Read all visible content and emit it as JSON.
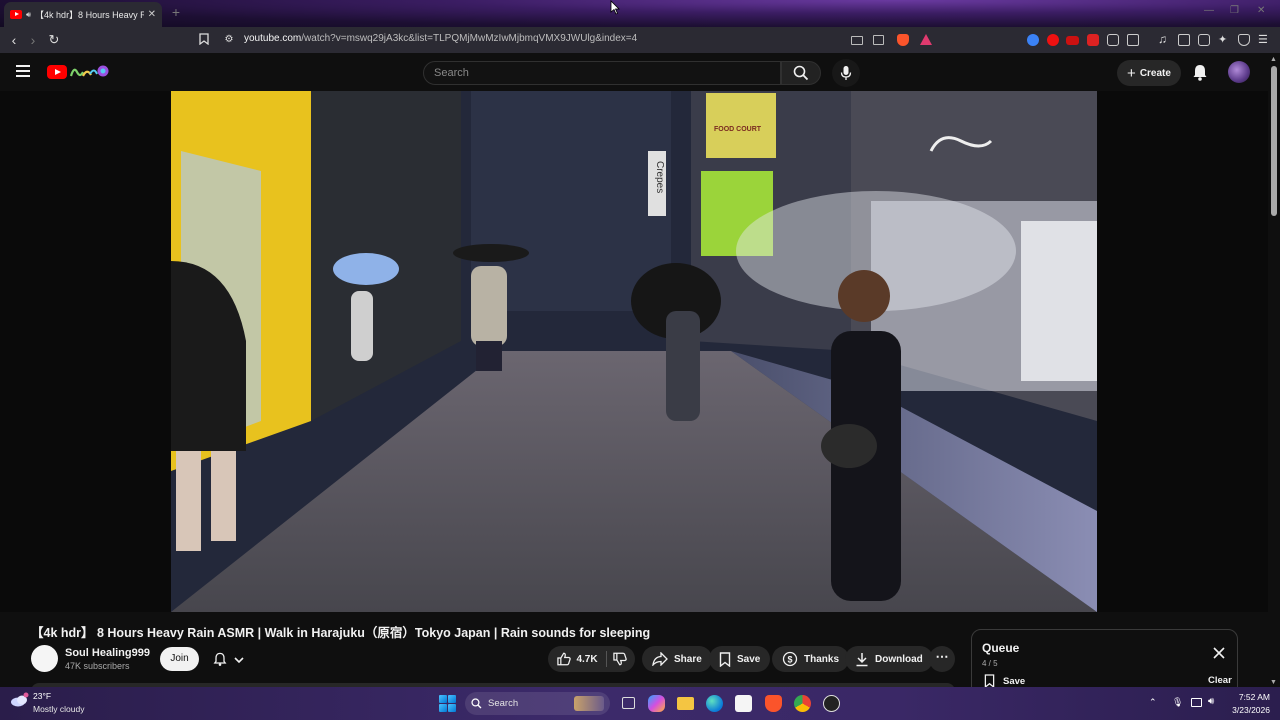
{
  "browser": {
    "tab_title": "【4k hdr】8 Hours Heavy Rain",
    "url_host": "youtube.com",
    "url_path": "/watch?v=mswq29jA3kc&list=TLPQMjMwMzIwMjbmqVMX9JWUlg&index=4"
  },
  "masthead": {
    "search_placeholder": "Search",
    "create_label": "Create"
  },
  "video": {
    "title": "【4k hdr】 8 Hours Heavy Rain ASMR | Walk in Harajuku（原宿）Tokyo Japan | Rain sounds for sleeping",
    "scene_signs": [
      "Crepes",
      "FOOD COURT"
    ]
  },
  "channel": {
    "name": "Soul Healing999",
    "subscribers": "47K subscribers",
    "join_label": "Join"
  },
  "actions": {
    "like_count": "4.7K",
    "share_label": "Share",
    "save_label": "Save",
    "thanks_label": "Thanks",
    "download_label": "Download"
  },
  "queue": {
    "title": "Queue",
    "count": "4 / 5",
    "save_label": "Save",
    "clear_label": "Clear"
  },
  "taskbar": {
    "weather_temp": "23°F",
    "weather_desc": "Mostly cloudy",
    "search_label": "Search",
    "time": "7:52 AM",
    "date": "3/23/2026"
  },
  "colors": {
    "youtube_red": "#ff0000",
    "background": "#0f0f0f",
    "pill": "#272727"
  }
}
